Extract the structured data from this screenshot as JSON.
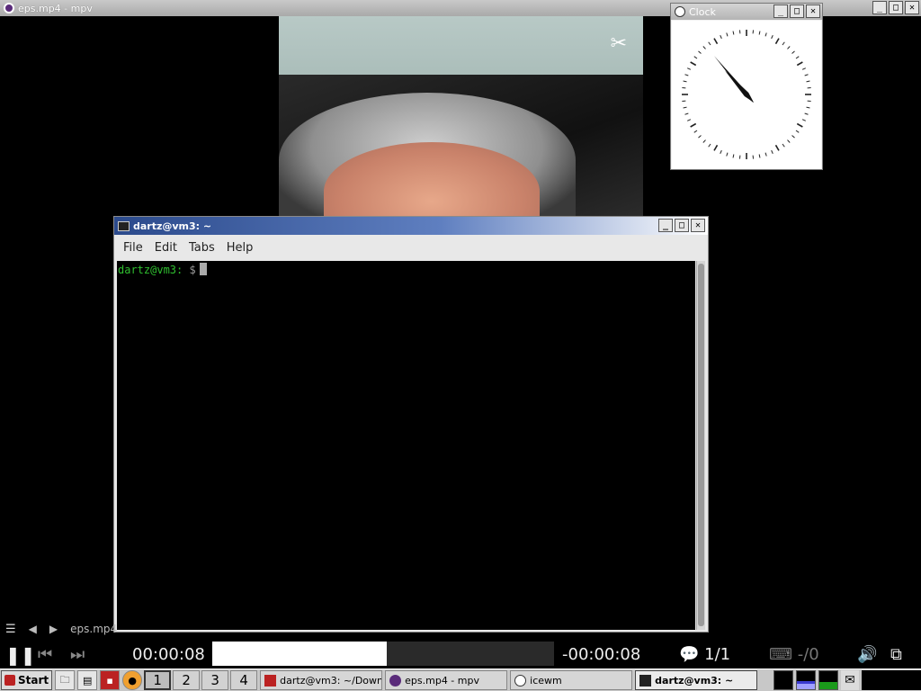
{
  "mpv_window": {
    "title": "eps.mp4 - mpv"
  },
  "clock_window": {
    "title": "Clock",
    "hour_angle_deg": 318,
    "minute_angle_deg": 320
  },
  "terminal_window": {
    "title": "dartz@vm3: ~",
    "menu": [
      "File",
      "Edit",
      "Tabs",
      "Help"
    ],
    "prompt_user": "dartz@vm3:",
    "prompt_symbol": " $"
  },
  "player": {
    "playlist_label": "eps.mp4",
    "current_time": "00:00:08",
    "remaining_time": "-00:00:08",
    "progress_fraction": 0.51,
    "chapters": "1/1",
    "subs": "-/0",
    "pause_glyph": "❚❚",
    "prev_glyph": "⏮",
    "next_glyph": "⏭",
    "menu_glyph": "☰",
    "left_glyph": "◀",
    "right_glyph": "▶",
    "volume_glyph": "🔊",
    "fullscreen_glyph": "⧉",
    "chat_glyph": "💬",
    "sub_glyph": "⌨"
  },
  "taskbar": {
    "start_label": "Start",
    "workspaces": [
      "1",
      "2",
      "3",
      "4"
    ],
    "tasks": [
      {
        "label": "dartz@vm3: ~/Down...",
        "icon": "terminal-icon"
      },
      {
        "label": "eps.mp4 - mpv",
        "icon": "mpv-icon"
      },
      {
        "label": "icewm",
        "icon": "clock-icon"
      },
      {
        "label": "dartz@vm3: ~",
        "icon": "terminal-icon",
        "active": true
      }
    ]
  },
  "video": {
    "overlay_logo": "✂"
  },
  "wm_buttons": {
    "min": "_",
    "max": "□",
    "close": "✕"
  }
}
